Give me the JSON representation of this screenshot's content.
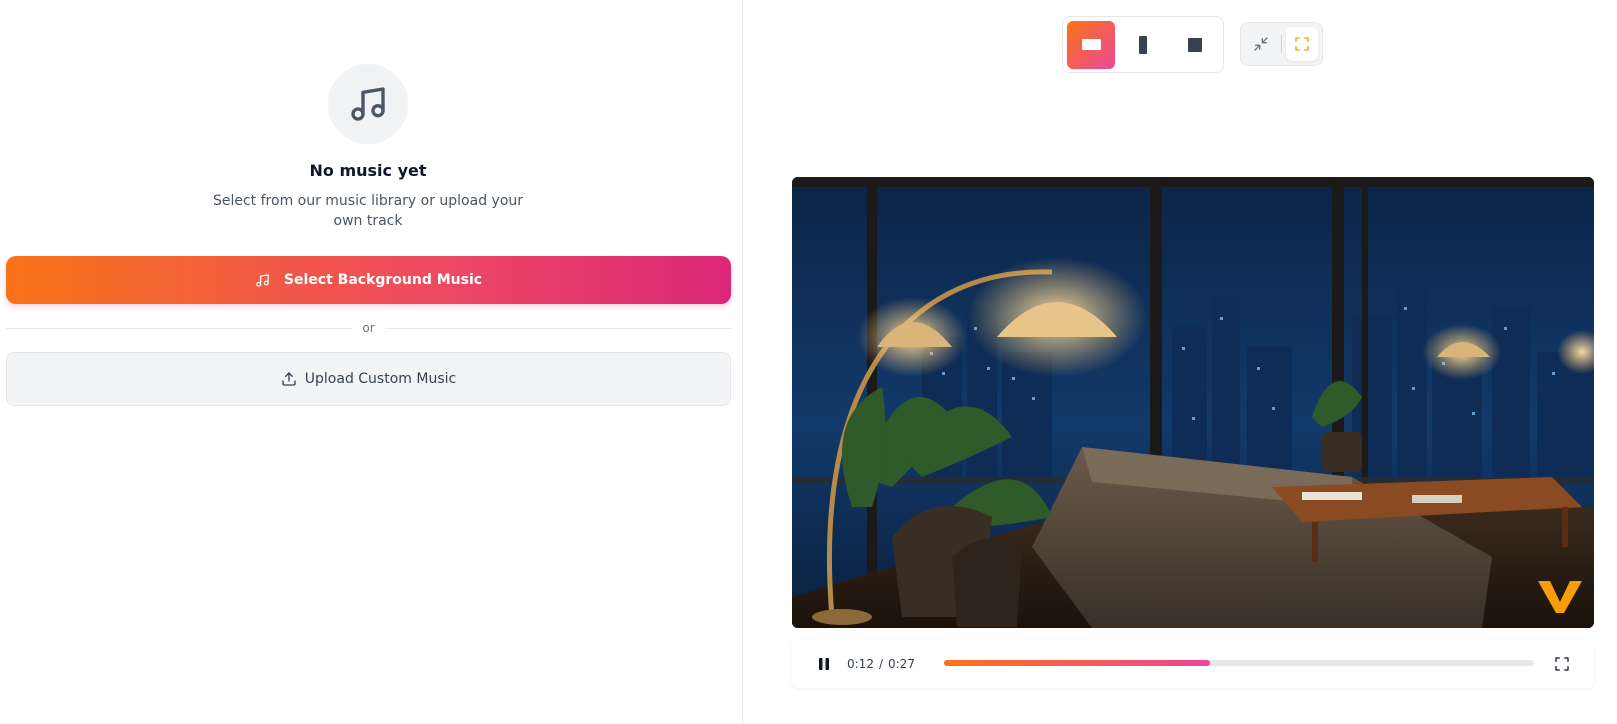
{
  "music": {
    "empty_title": "No music yet",
    "empty_description": "Select from our music library or upload your own track",
    "select_button_label": "Select Background Music",
    "divider_text": "or",
    "upload_button_label": "Upload Custom Music",
    "icons": {
      "empty": "music-note-icon",
      "select": "music-note-icon",
      "upload": "upload-icon"
    }
  },
  "aspect_ratio": {
    "options": [
      {
        "name": "landscape",
        "icon": "landscape-ratio-icon",
        "active": true
      },
      {
        "name": "portrait",
        "icon": "portrait-ratio-icon",
        "active": false
      },
      {
        "name": "square",
        "icon": "square-ratio-icon",
        "active": false
      }
    ]
  },
  "fit_mode": {
    "options": [
      {
        "name": "fit",
        "icon": "minimize-icon",
        "active": false
      },
      {
        "name": "fill",
        "icon": "expand-icon",
        "active": true
      }
    ]
  },
  "player": {
    "current_time": "0:12",
    "separator": "/",
    "duration": "0:27",
    "progress": 0.45,
    "state": "playing",
    "icons": {
      "play_pause": "pause-icon",
      "fullscreen": "fullscreen-icon"
    }
  },
  "colors": {
    "accent_start": "#f97316",
    "accent_end": "#ec4899",
    "watermark": "#f59e0b"
  }
}
